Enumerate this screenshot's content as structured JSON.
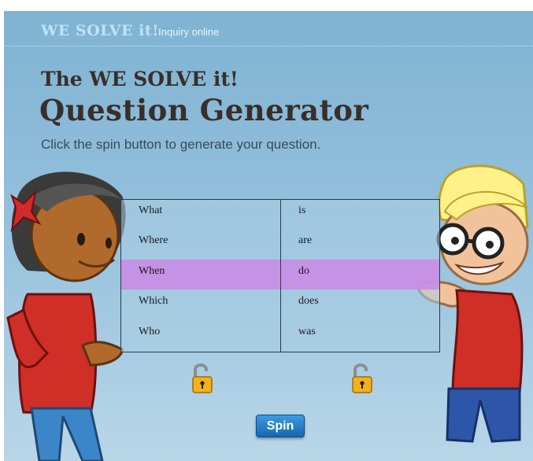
{
  "header": {
    "brand": "WE SOLVE it!",
    "section": "Inquiry online"
  },
  "main": {
    "title_line1": "The WE SOLVE it!",
    "title_line2": "Question Generator",
    "instructions": "Click the spin button to generate your question."
  },
  "generator": {
    "left_words": [
      "What",
      "Where",
      "When",
      "Which",
      "Who"
    ],
    "right_words": [
      "is",
      "are",
      "do",
      "does",
      "was"
    ],
    "selected_left": "When",
    "selected_right": "do",
    "highlight_color": "#c98ce6",
    "left_lock_icon": "unlocked-padlock-icon",
    "right_lock_icon": "unlocked-padlock-icon"
  },
  "controls": {
    "spin_label": "Spin",
    "spin_color": "#1f7ccc"
  },
  "colors": {
    "background": "#8fbcd9",
    "title": "#3a2e2a",
    "brand": "#bfe2f6"
  }
}
